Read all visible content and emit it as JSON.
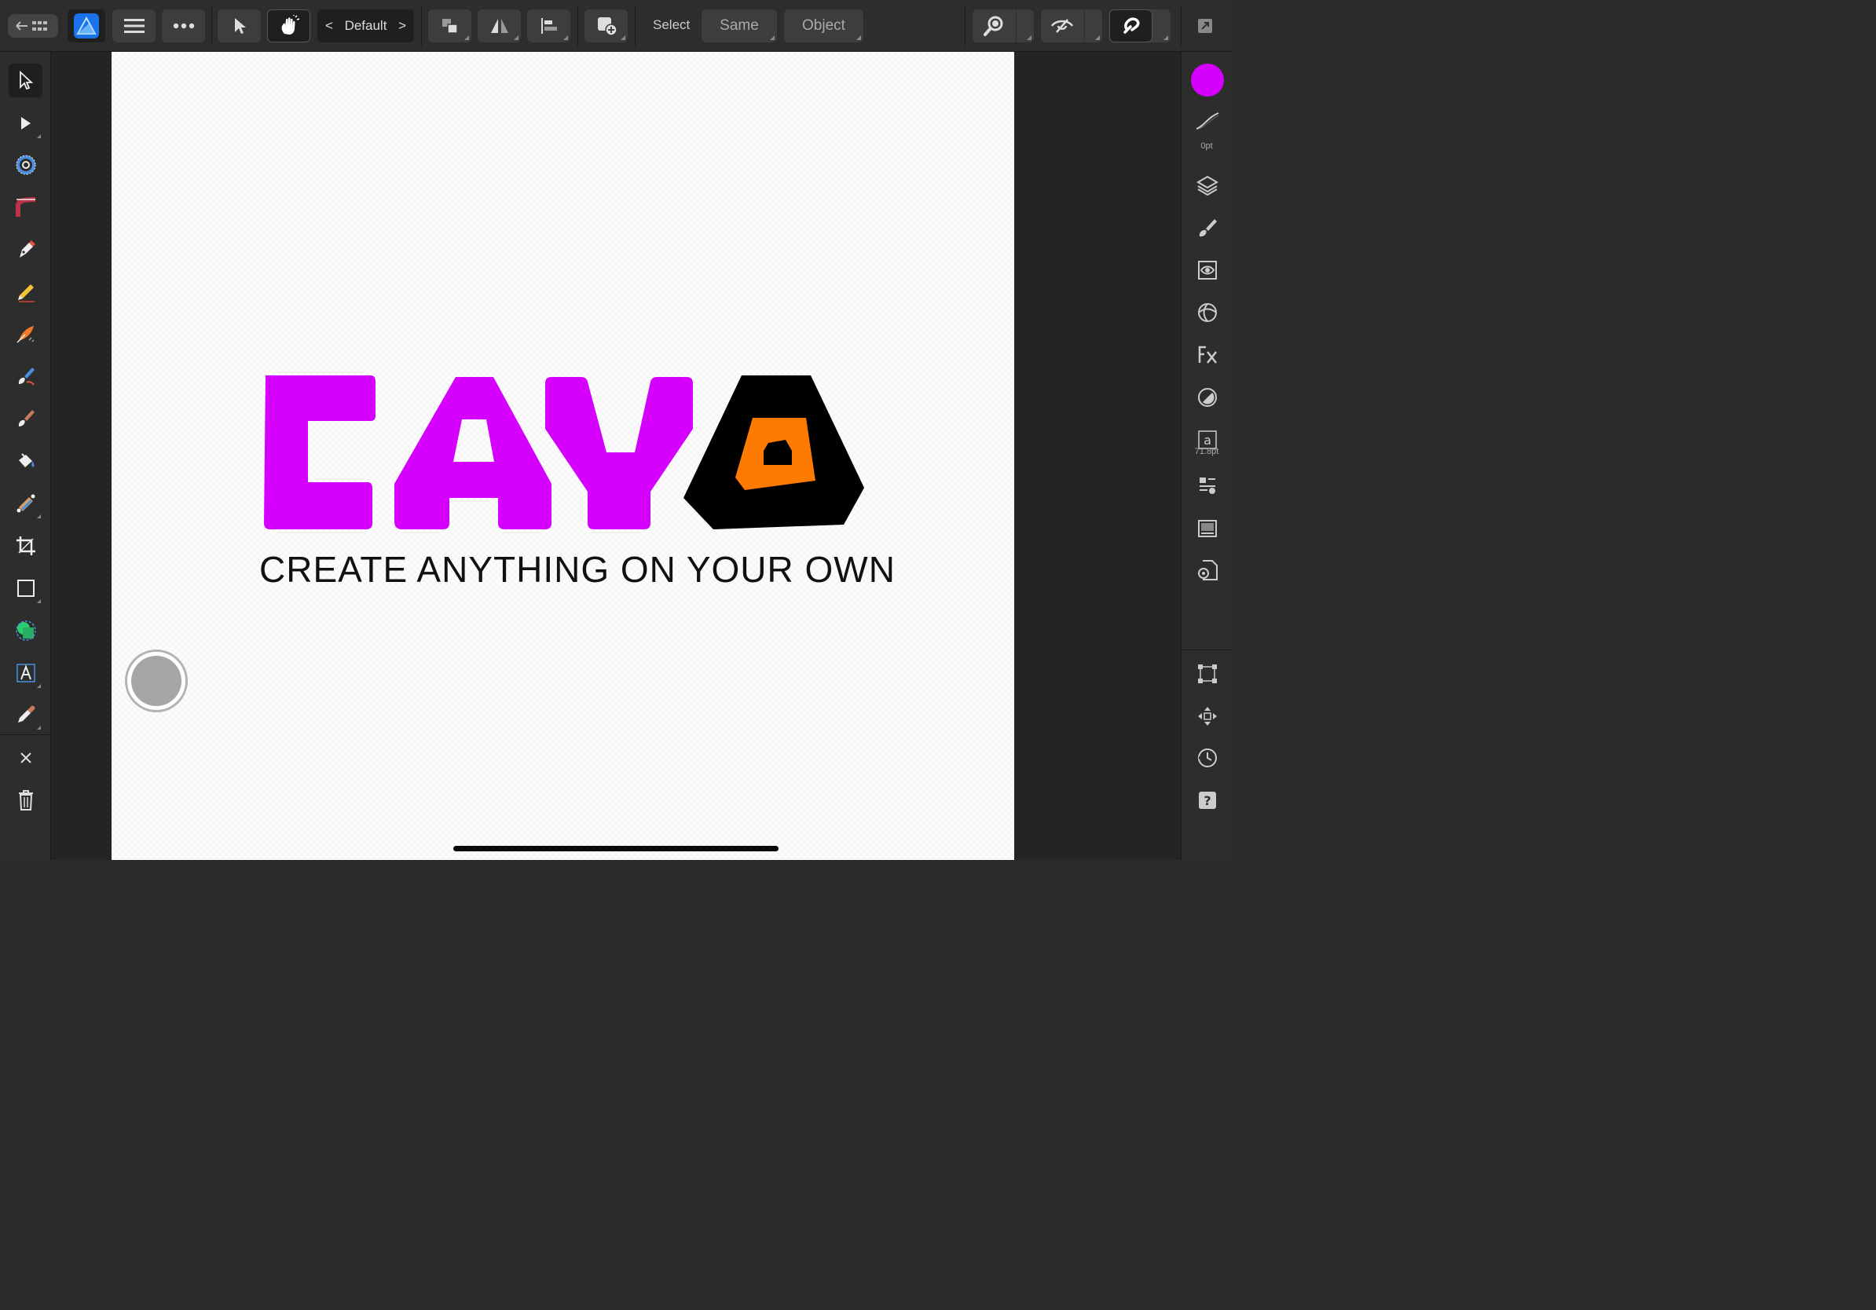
{
  "app": {
    "name": "Affinity Designer"
  },
  "toolbar": {
    "persona_label": "Default",
    "select_label": "Select",
    "same_label": "Same",
    "object_label": "Object"
  },
  "document": {
    "logo_text": "CAYO",
    "tagline": "CREATE ANYTHING ON YOUR OWN",
    "colors": {
      "magenta": "#d600ff",
      "black": "#000000",
      "orange": "#ff7a00"
    }
  },
  "right_panel": {
    "fill_color": "#d600ff",
    "stroke_width_label": "0pt",
    "text_size_label": "71.8pt"
  },
  "tools": [
    "move-tool",
    "node-tool",
    "corner-tool",
    "point-transform-tool",
    "pen-tool",
    "pencil-tool",
    "vector-brush-tool",
    "paint-brush-tool",
    "pixel-brush-tool",
    "fill-tool",
    "transparency-tool",
    "crop-tool",
    "rectangle-tool",
    "shape-builder-tool",
    "artistic-text-tool",
    "color-picker-tool"
  ]
}
